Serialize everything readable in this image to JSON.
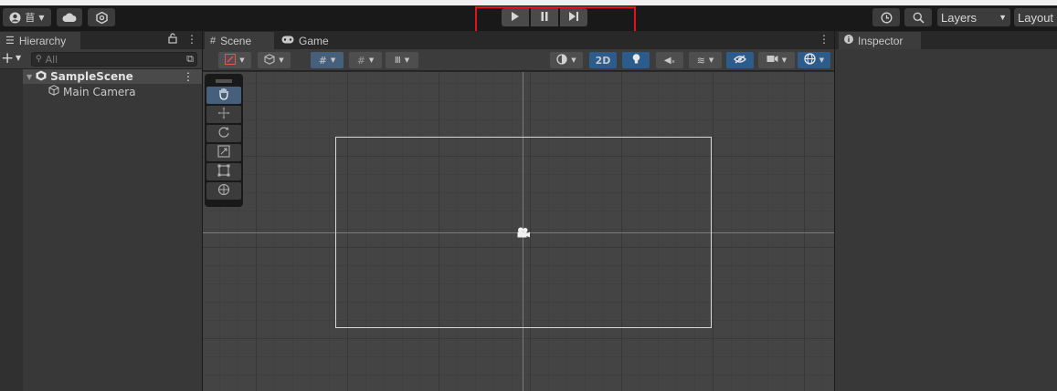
{
  "main_toolbar": {
    "account_icon": "account-icon",
    "cloud_icon": "cloud-icon",
    "collab_icon": "collab-icon",
    "play": {
      "icon": "play-icon"
    },
    "pause": {
      "icon": "pause-icon"
    },
    "step": {
      "icon": "step-icon"
    },
    "history_icon": "history-icon",
    "search_icon": "search-icon",
    "layers_label": "Layers",
    "layout_label": "Layout"
  },
  "hierarchy": {
    "tab_label": "Hierarchy",
    "search_placeholder": "All",
    "items": [
      {
        "label": "SampleScene",
        "icon": "unity-scene-icon"
      },
      {
        "label": "Main Camera",
        "icon": "cube-icon"
      }
    ]
  },
  "scene": {
    "tabs": [
      {
        "label": "Scene",
        "icon": "grid-icon"
      },
      {
        "label": "Game",
        "icon": "gamepad-icon"
      }
    ],
    "toolbar": {
      "two_d_label": "2D"
    },
    "tools": [
      "hand-tool",
      "move-tool",
      "rotate-tool",
      "scale-tool",
      "rect-tool",
      "transform-tool"
    ]
  },
  "inspector": {
    "tab_label": "Inspector"
  },
  "colors": {
    "highlight": "#e5121b",
    "accent_blue": "#46607c"
  }
}
